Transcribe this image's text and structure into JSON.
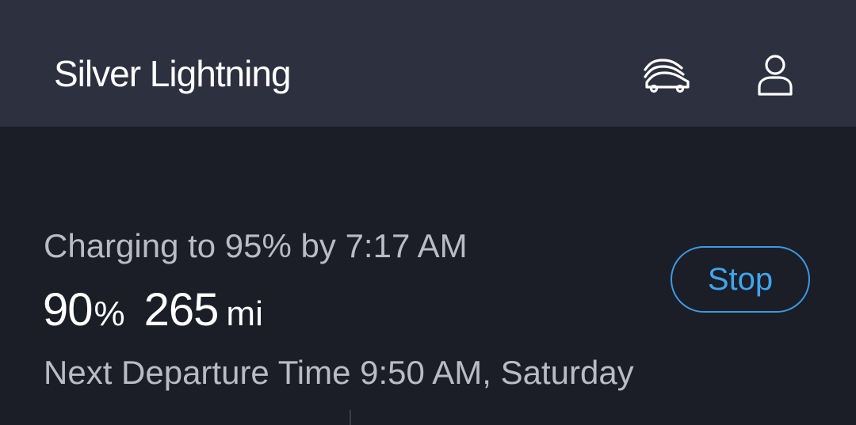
{
  "header": {
    "title": "Silver Lightning",
    "garage_icon": "garage-cars-icon",
    "account_icon": "account-person-icon"
  },
  "charging": {
    "status_text": "Charging to 95% by 7:17 AM",
    "battery_percent": "90",
    "battery_percent_unit": "%",
    "range_value": "265",
    "range_unit": "mi",
    "stop_label": "Stop",
    "departure_text": "Next Departure Time 9:50 AM, Saturday"
  },
  "colors": {
    "header_bg": "#2d303e",
    "page_bg": "#1b1d27",
    "accent": "#3ea6ee",
    "secondary_text": "#b9bcc4"
  }
}
